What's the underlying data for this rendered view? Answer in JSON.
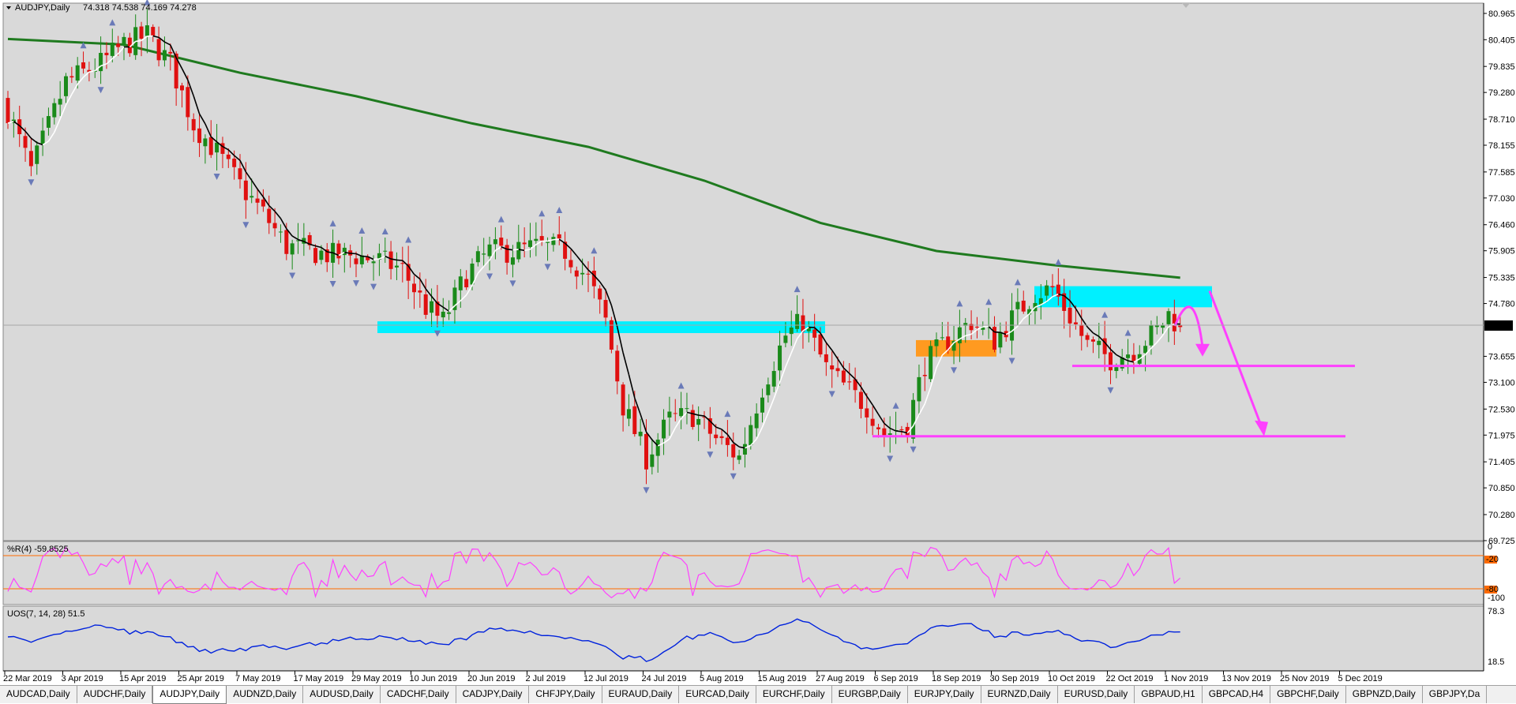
{
  "header": {
    "symbol": "AUDJPY,Daily",
    "ohlc": "74.318 74.538 74.169 74.278"
  },
  "price_axis": {
    "ticks": [
      "80.965",
      "80.405",
      "79.835",
      "79.280",
      "78.710",
      "78.155",
      "77.585",
      "77.030",
      "76.460",
      "75.905",
      "75.335",
      "74.780",
      "74.278",
      "73.655",
      "73.100",
      "72.530",
      "71.975",
      "71.405",
      "70.850",
      "70.280",
      "69.725"
    ],
    "current": "74.278"
  },
  "time_axis": {
    "ticks": [
      "22 Mar 2019",
      "3 Apr 2019",
      "15 Apr 2019",
      "25 Apr 2019",
      "7 May 2019",
      "17 May 2019",
      "29 May 2019",
      "10 Jun 2019",
      "20 Jun 2019",
      "2 Jul 2019",
      "12 Jul 2019",
      "24 Jul 2019",
      "5 Aug 2019",
      "15 Aug 2019",
      "27 Aug 2019",
      "6 Sep 2019",
      "18 Sep 2019",
      "30 Sep 2019",
      "10 Oct 2019",
      "22 Oct 2019",
      "1 Nov 2019",
      "13 Nov 2019",
      "25 Nov 2019",
      "5 Dec 2019"
    ]
  },
  "wpr": {
    "label": "%R(4) -59.8525",
    "scale_top": "0",
    "scale_bottom": "-100",
    "level_high": "-20",
    "level_low": "-80"
  },
  "uos": {
    "label": "UOS(7, 14, 28) 51.5",
    "scale_top": "78.3",
    "scale_bottom": "18.5"
  },
  "tabs": [
    {
      "label": "AUDCAD,Daily",
      "active": false
    },
    {
      "label": "AUDCHF,Daily",
      "active": false
    },
    {
      "label": "AUDJPY,Daily",
      "active": true
    },
    {
      "label": "AUDNZD,Daily",
      "active": false
    },
    {
      "label": "AUDUSD,Daily",
      "active": false
    },
    {
      "label": "CADCHF,Daily",
      "active": false
    },
    {
      "label": "CADJPY,Daily",
      "active": false
    },
    {
      "label": "CHFJPY,Daily",
      "active": false
    },
    {
      "label": "EURAUD,Daily",
      "active": false
    },
    {
      "label": "EURCAD,Daily",
      "active": false
    },
    {
      "label": "EURCHF,Daily",
      "active": false
    },
    {
      "label": "EURGBP,Daily",
      "active": false
    },
    {
      "label": "EURJPY,Daily",
      "active": false
    },
    {
      "label": "EURNZD,Daily",
      "active": false
    },
    {
      "label": "EURUSD,Daily",
      "active": false
    },
    {
      "label": "GBPAUD,H1",
      "active": false
    },
    {
      "label": "GBPCAD,H4",
      "active": false
    },
    {
      "label": "GBPCHF,Daily",
      "active": false
    },
    {
      "label": "GBPNZD,Daily",
      "active": false
    },
    {
      "label": "GBPJPY,Da",
      "active": false
    }
  ],
  "colors": {
    "chart_bg": "#d9d9d9",
    "bull": "#1a8a1a",
    "bear": "#e01010",
    "ma_long": "#1f7a1f",
    "zone_cyan": "#00f0ff",
    "zone_orange": "#ff9a20",
    "projection": "#ff40ff",
    "wpr_line": "#ff40ff",
    "wpr_levels": "#ff6a00",
    "uos_line": "#0022dd"
  },
  "chart_data": {
    "type": "candlestick",
    "symbol": "AUDJPY",
    "timeframe": "Daily",
    "x_range": [
      "22 Mar 2019",
      "9 Dec 2019"
    ],
    "ylim": [
      69.725,
      81.2
    ],
    "close_path": [
      {
        "i": 0,
        "p": 78.9
      },
      {
        "i": 4,
        "p": 77.6
      },
      {
        "i": 10,
        "p": 79.5
      },
      {
        "i": 16,
        "p": 79.9
      },
      {
        "i": 20,
        "p": 80.3
      },
      {
        "i": 24,
        "p": 80.5
      },
      {
        "i": 28,
        "p": 79.9
      },
      {
        "i": 32,
        "p": 78.6
      },
      {
        "i": 36,
        "p": 78.0
      },
      {
        "i": 40,
        "p": 77.3
      },
      {
        "i": 44,
        "p": 76.7
      },
      {
        "i": 48,
        "p": 76.0
      },
      {
        "i": 52,
        "p": 75.9
      },
      {
        "i": 56,
        "p": 75.8
      },
      {
        "i": 60,
        "p": 75.8
      },
      {
        "i": 64,
        "p": 75.7
      },
      {
        "i": 68,
        "p": 75.5
      },
      {
        "i": 72,
        "p": 74.7
      },
      {
        "i": 75,
        "p": 74.4
      },
      {
        "i": 79,
        "p": 75.4
      },
      {
        "i": 83,
        "p": 75.9
      },
      {
        "i": 87,
        "p": 75.9
      },
      {
        "i": 92,
        "p": 76.0
      },
      {
        "i": 96,
        "p": 75.9
      },
      {
        "i": 100,
        "p": 75.3
      },
      {
        "i": 103,
        "p": 74.4
      },
      {
        "i": 106,
        "p": 72.6
      },
      {
        "i": 110,
        "p": 71.5
      },
      {
        "i": 114,
        "p": 72.3
      },
      {
        "i": 118,
        "p": 72.4
      },
      {
        "i": 122,
        "p": 71.9
      },
      {
        "i": 126,
        "p": 71.5
      },
      {
        "i": 130,
        "p": 73.0
      },
      {
        "i": 134,
        "p": 74.1
      },
      {
        "i": 137,
        "p": 74.4
      },
      {
        "i": 141,
        "p": 73.4
      },
      {
        "i": 145,
        "p": 72.9
      },
      {
        "i": 148,
        "p": 72.6
      },
      {
        "i": 151,
        "p": 72.0
      },
      {
        "i": 155,
        "p": 72.2
      },
      {
        "i": 158,
        "p": 73.5
      },
      {
        "i": 162,
        "p": 74.0
      },
      {
        "i": 166,
        "p": 74.4
      },
      {
        "i": 170,
        "p": 74.0
      },
      {
        "i": 174,
        "p": 74.6
      },
      {
        "i": 177,
        "p": 75.0
      },
      {
        "i": 180,
        "p": 75.1
      },
      {
        "i": 183,
        "p": 74.5
      },
      {
        "i": 186,
        "p": 73.9
      },
      {
        "i": 190,
        "p": 73.6
      },
      {
        "i": 194,
        "p": 73.8
      },
      {
        "i": 198,
        "p": 74.2
      },
      {
        "i": 200,
        "p": 74.55
      },
      {
        "i": 202,
        "p": 74.278
      }
    ],
    "ma_long": [
      {
        "i": 0,
        "p": 80.42
      },
      {
        "i": 20,
        "p": 80.3
      },
      {
        "i": 40,
        "p": 79.7
      },
      {
        "i": 60,
        "p": 79.2
      },
      {
        "i": 80,
        "p": 78.62
      },
      {
        "i": 100,
        "p": 78.12
      },
      {
        "i": 120,
        "p": 77.4
      },
      {
        "i": 140,
        "p": 76.5
      },
      {
        "i": 160,
        "p": 75.9
      },
      {
        "i": 180,
        "p": 75.6
      },
      {
        "i": 202,
        "p": 75.33
      }
    ],
    "zones": [
      {
        "kind": "resistance",
        "from": "4 Dec 2019",
        "to": "12 Dec 2019",
        "low": 74.75,
        "high": 75.15,
        "color": "cyan"
      },
      {
        "kind": "resistance",
        "from": "4 Nov 2019",
        "to": "12 Dec 2019",
        "low": 74.7,
        "high": 75.1,
        "color": "cyan"
      },
      {
        "kind": "support",
        "from": "10 Jun 2019",
        "to": "12 Sep 2019",
        "low": 74.15,
        "high": 74.4,
        "color": "cyan"
      },
      {
        "kind": "support",
        "from": "10 Oct 2019",
        "to": "24 Oct 2019",
        "low": 73.65,
        "high": 74.0,
        "color": "orange"
      }
    ],
    "levels": [
      {
        "price": 73.45,
        "from": "13 Nov 2019",
        "to": "27 Dec 2019"
      },
      {
        "price": 71.95,
        "from": "30 Sep 2019",
        "to": "27 Dec 2019"
      }
    ],
    "projection": [
      {
        "from": [
          202,
          74.3
        ],
        "via": [
          205,
          74.85
        ],
        "to": [
          208,
          73.65
        ]
      },
      {
        "from": [
          206,
          74.9
        ],
        "to": [
          212,
          71.95
        ]
      }
    ]
  }
}
